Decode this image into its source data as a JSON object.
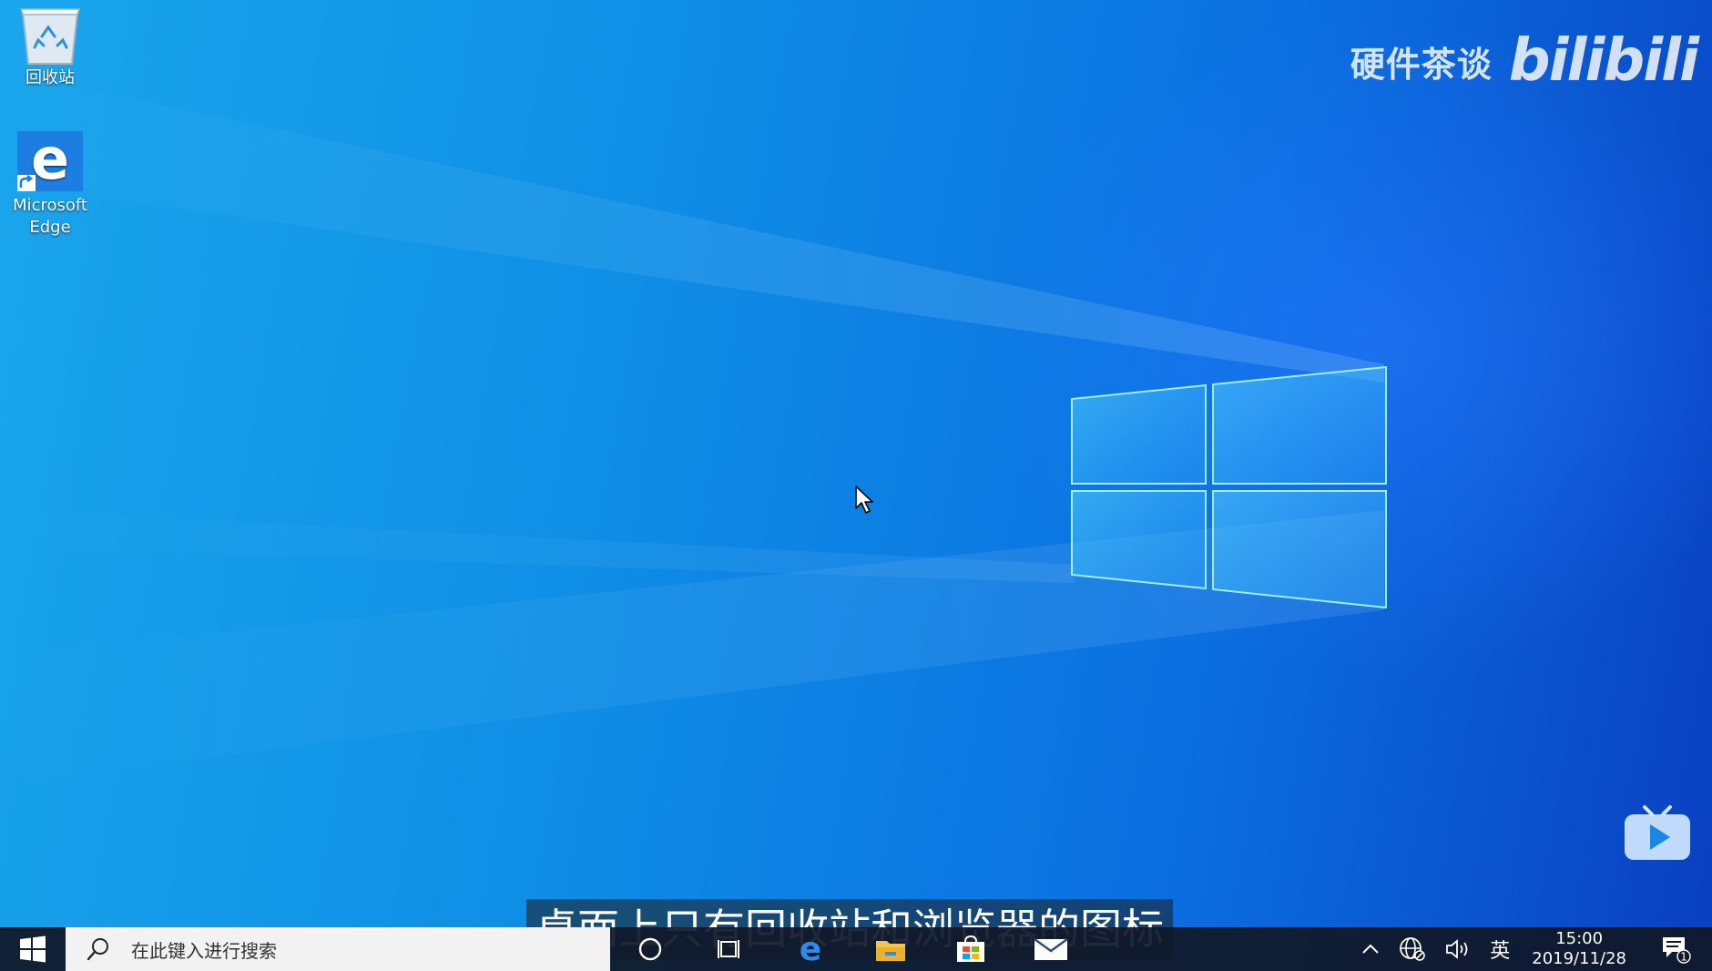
{
  "desktop": {
    "icons": [
      {
        "label": "回收站",
        "icon": "recycle-bin-icon"
      },
      {
        "label": "Microsoft Edge",
        "icon": "edge-icon"
      }
    ]
  },
  "watermark": {
    "text": "硬件茶谈",
    "logo": "bilibili"
  },
  "subtitle": "桌面上只有回收站和浏览器的图标",
  "taskbar": {
    "search_placeholder": "在此键入进行搜索",
    "apps": [
      "cortana-icon",
      "task-view-icon",
      "edge-icon",
      "file-explorer-icon",
      "store-icon",
      "mail-icon"
    ],
    "tray": {
      "language": "英",
      "time": "15:00",
      "date": "2019/11/28",
      "notification_count": "1"
    }
  },
  "colors": {
    "wallpaper_light": "#1aa6ec",
    "wallpaper_dark": "#0a3fc2",
    "taskbar": "#101828",
    "logo_glow": "#7fe9ff"
  }
}
